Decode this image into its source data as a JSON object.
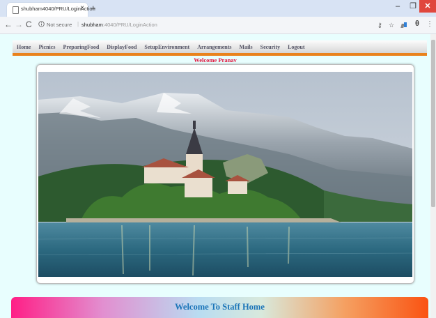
{
  "browser": {
    "tab_title": "shubham4040/PRU/LoginAction",
    "tab_close": "×",
    "new_tab": "+",
    "address": {
      "security_label": "Not secure",
      "separator": "|",
      "host": "shubham",
      "path": ":4040/PRU/LoginAction"
    },
    "window_controls": {
      "minimize": "–",
      "maximize": "❐",
      "close": "✕"
    },
    "nav": {
      "back": "←",
      "forward": "→",
      "reload": "C"
    },
    "tools": {
      "key": "⚷",
      "star": "☆",
      "profile": "θ",
      "menu": "⋮"
    }
  },
  "navbar": {
    "items": [
      "Home",
      "Picnics",
      "PreparingFood",
      "DisplayFood",
      "SetupEnvironment",
      "Arrangements",
      "Mails",
      "Security",
      "Logout"
    ]
  },
  "welcome_user": "Welcome Pranav",
  "banner": {
    "text": "Welcome To Staff Home"
  },
  "colors": {
    "nav_underline": "#e9821c",
    "welcome_user": "#e0113a",
    "banner_text": "#1a74b8",
    "page_bg": "#e8fefe"
  }
}
